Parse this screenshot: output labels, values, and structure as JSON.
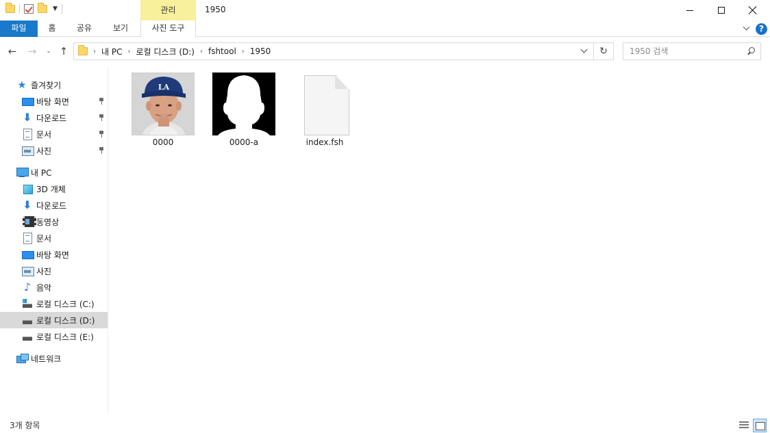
{
  "window": {
    "title": "1950",
    "context_tab_group": "관리"
  },
  "ribbon": {
    "tabs": [
      "파일",
      "홈",
      "공유",
      "보기",
      "사진 도구"
    ]
  },
  "address": {
    "crumbs": [
      "내 PC",
      "로컬 디스크 (D:)",
      "fshtool",
      "1950"
    ]
  },
  "search": {
    "placeholder": "1950 검색"
  },
  "nav": {
    "quick_access": "즐겨찾기",
    "quick_items": [
      "바탕 화면",
      "다운로드",
      "문서",
      "사진"
    ],
    "this_pc": "내 PC",
    "pc_items": [
      "3D 개체",
      "다운로드",
      "동영상",
      "문서",
      "바탕 화면",
      "사진",
      "음악",
      "로컬 디스크 (C:)",
      "로컬 디스크 (D:)",
      "로컬 디스크 (E:)"
    ],
    "network": "네트워크",
    "selected": "로컬 디스크 (D:)"
  },
  "files": [
    {
      "name": "0000",
      "kind": "photo"
    },
    {
      "name": "0000-a",
      "kind": "alpha-mask"
    },
    {
      "name": "index.fsh",
      "kind": "document"
    }
  ],
  "status": {
    "count_text": "3개 항목"
  },
  "colors": {
    "accent": "#1979ca",
    "context_tab": "#f8f09a",
    "selection": "#d9d9d9"
  }
}
